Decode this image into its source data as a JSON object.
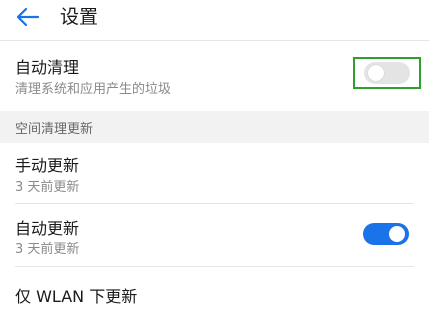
{
  "header": {
    "title": "设置"
  },
  "auto_clean": {
    "title": "自动清理",
    "subtitle": "清理系统和应用产生的垃圾",
    "enabled": false
  },
  "section": {
    "title": "空间清理更新"
  },
  "manual_update": {
    "title": "手动更新",
    "subtitle": "3 天前更新"
  },
  "auto_update": {
    "title": "自动更新",
    "subtitle": "3 天前更新",
    "enabled": true
  },
  "wlan_update": {
    "title": "仅 WLAN 下更新"
  },
  "colors": {
    "accent": "#1a73e8",
    "highlight": "#2ea02e"
  }
}
